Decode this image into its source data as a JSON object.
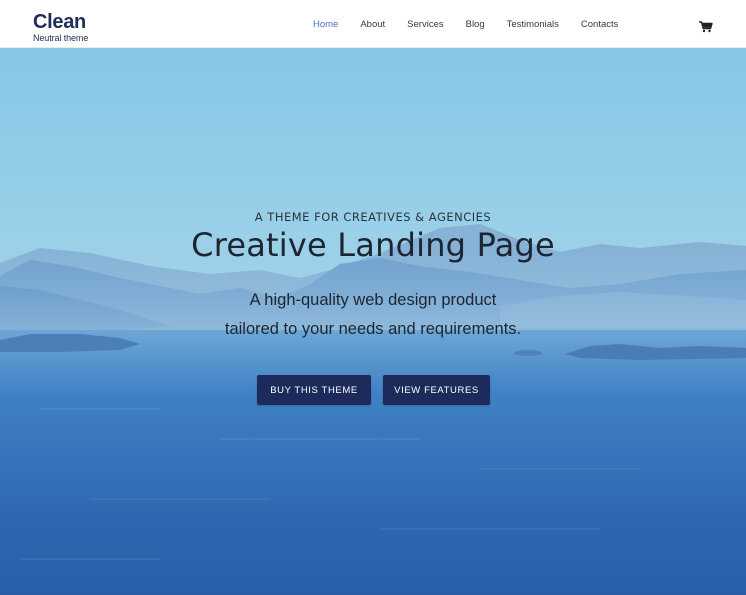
{
  "brand": {
    "title": "Clean",
    "subtitle": "Neutral theme",
    "color": "#1f2d5a"
  },
  "nav": {
    "items": [
      {
        "label": "Home",
        "active": true
      },
      {
        "label": "About",
        "active": false
      },
      {
        "label": "Services",
        "active": false
      },
      {
        "label": "Blog",
        "active": false
      },
      {
        "label": "Testimonials",
        "active": false
      },
      {
        "label": "Contacts",
        "active": false
      }
    ],
    "active_color": "#4a6fd0",
    "cart_icon": "shopping-cart-icon"
  },
  "hero": {
    "eyebrow": "A THEME FOR CREATIVES & AGENCIES",
    "headline": "Creative Landing Page",
    "description_line1": "A high-quality web design product",
    "description_line2": "tailored to your needs and requirements.",
    "buttons": {
      "buy_label": "BUY THIS THEME",
      "features_label": "VIEW FEATURES"
    },
    "button_color": "#1c2b5c",
    "background": "sea-and-mountains-image"
  }
}
